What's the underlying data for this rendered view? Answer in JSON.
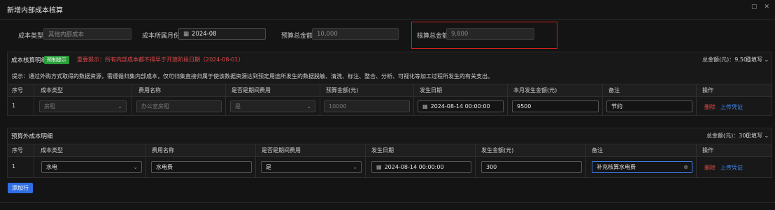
{
  "dialog": {
    "title": "新增内部成本核算"
  },
  "form": {
    "cost_type": {
      "label": "成本类型",
      "placeholder": "其他内部成本"
    },
    "month": {
      "label": "成本所属月份",
      "value": "2024-08"
    },
    "budget_total": {
      "label": "预算总金额",
      "value": "10,000"
    },
    "check_total": {
      "label": "核算总金额",
      "value": "9,800"
    }
  },
  "budget_section": {
    "title": "成本核算明细",
    "tag": "预制提示",
    "warning": "重要提示：所有内部成本都不得早于开放阶段日期（2024-08-01）",
    "total": "总金额(元)：9,500",
    "status": "已填写",
    "hint": "提示：通过外购方式取得的数据资源，需遵循归集内部成本，仅可归集直接归属于使该数据资源达到预定用途所发生的数据脱敏、清洗、标注、整合、分析、可视化等加工过程所发生的有关支出。",
    "columns": [
      "序号",
      "成本类型",
      "费用名称",
      "是否是期间费用",
      "预算金额(元)",
      "发生日期",
      "本月发生金额(元)",
      "备注",
      "操作"
    ],
    "rows": [
      {
        "index": "1",
        "type": "房租",
        "name": "办公室房租",
        "period": "是",
        "budget": "10000",
        "date": "2024-08-14 00:00:00",
        "amount": "9500",
        "note": "节约",
        "delete": "删除",
        "upload": "上传凭证"
      }
    ]
  },
  "extra_section": {
    "title": "预算外成本明细",
    "total": "总金额(元)：300",
    "status": "已填写",
    "columns": [
      "序号",
      "成本类型",
      "费用名称",
      "是否是期间费用",
      "发生日期",
      "发生金额(元)",
      "备注",
      "操作"
    ],
    "rows": [
      {
        "index": "1",
        "type": "水电",
        "name": "水电费",
        "period": "是",
        "date": "2024-08-14 00:00:00",
        "amount": "300",
        "note": "补充核算水电费",
        "delete": "删除",
        "upload": "上传凭证"
      }
    ],
    "add_button": "添加行"
  }
}
